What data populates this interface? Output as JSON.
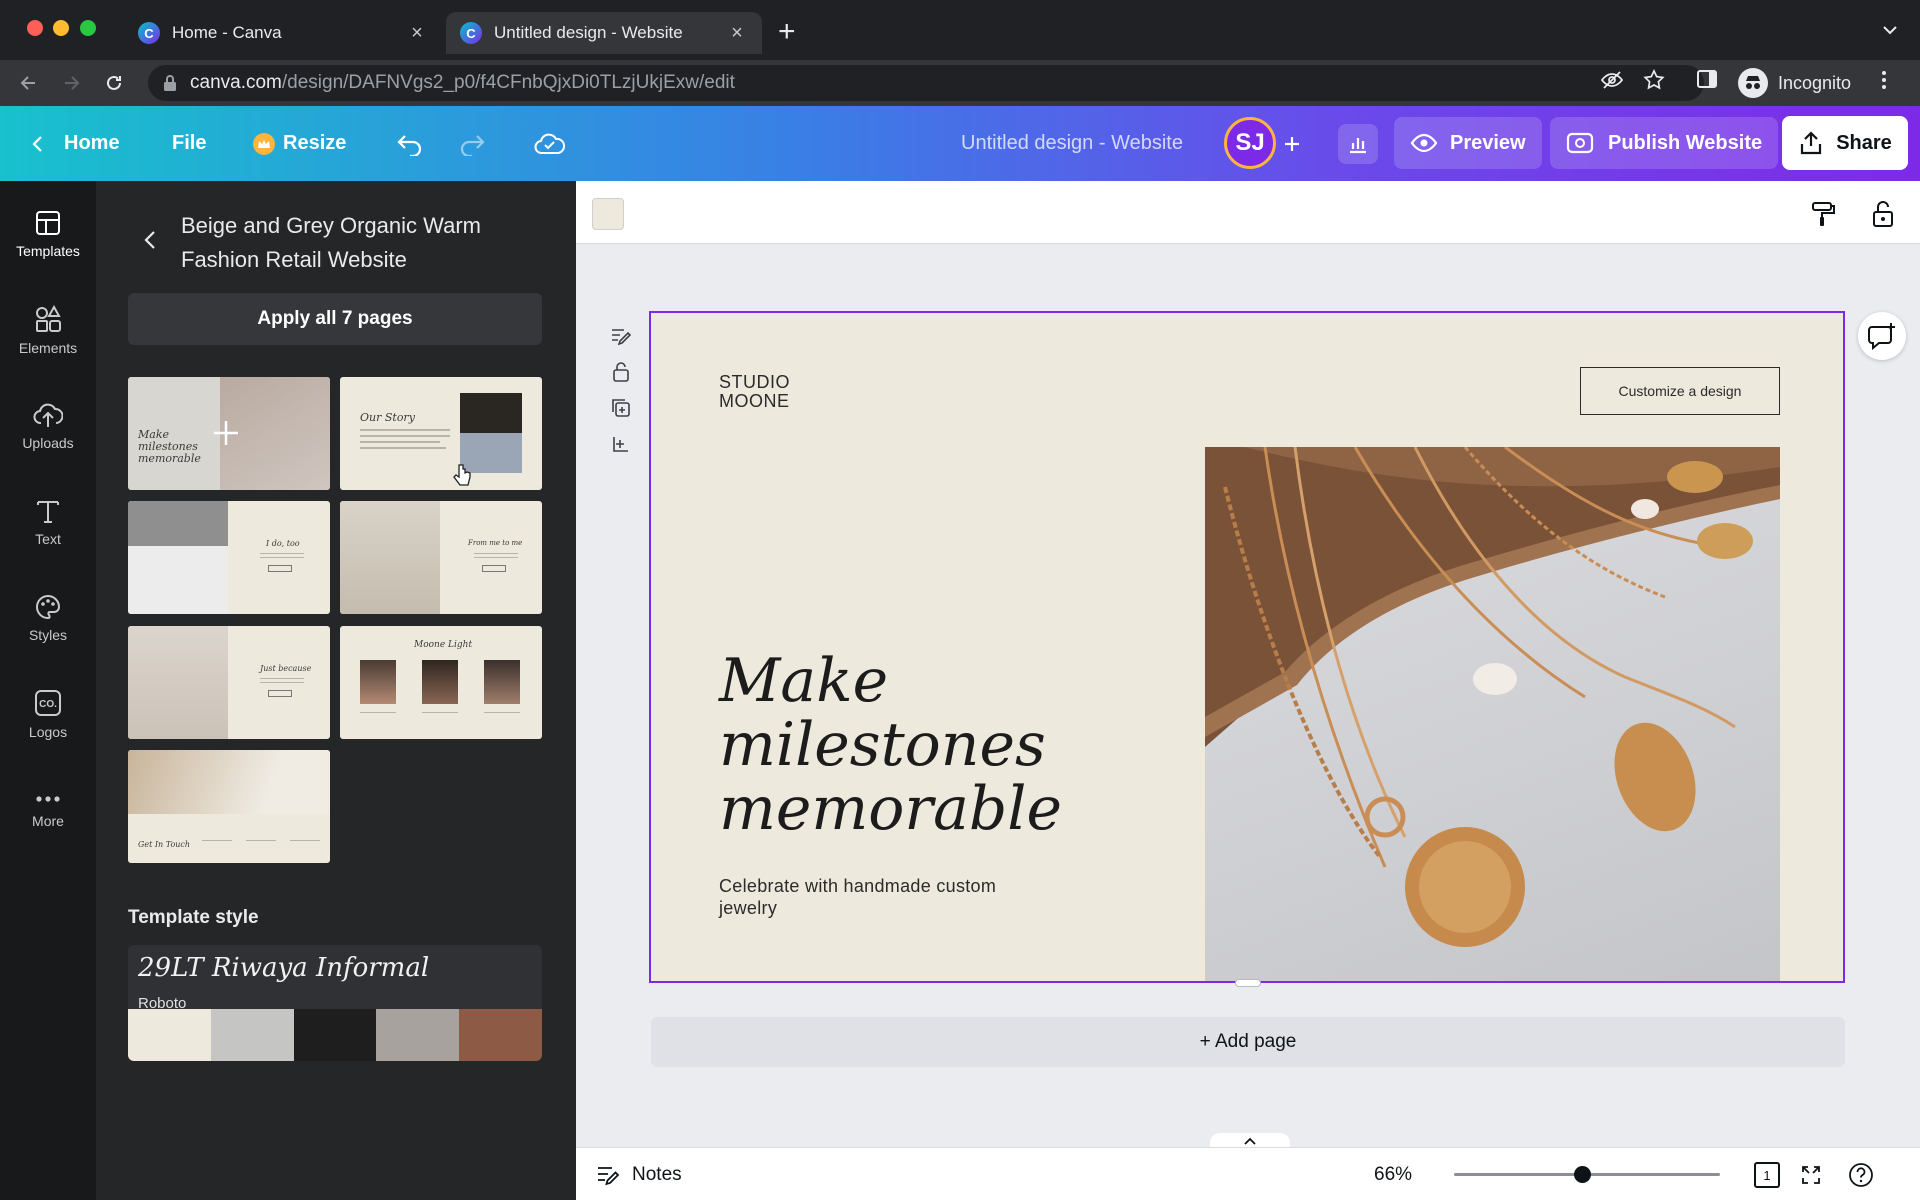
{
  "browser": {
    "tabs": [
      {
        "title": "Home - Canva",
        "favicon": "C"
      },
      {
        "title": "Untitled design - Website",
        "favicon": "C"
      }
    ],
    "new_tab_label": "+",
    "close_glyph": "×",
    "url_host": "canva.com",
    "url_path": "/design/DAFNVgs2_p0/f4CFnbQjxDi0TLzjUkjExw/edit",
    "profile_label": "Incognito"
  },
  "header": {
    "home_label": "Home",
    "file_label": "File",
    "resize_label": "Resize",
    "doc_title": "Untitled design - Website",
    "avatar_initials": "SJ",
    "add_glyph": "+",
    "preview_label": "Preview",
    "publish_label": "Publish Website",
    "share_label": "Share",
    "gradient_start": "#18c1cd",
    "gradient_end": "#7d2ae8"
  },
  "rail": [
    {
      "label": "Templates",
      "icon": "templates-icon"
    },
    {
      "label": "Elements",
      "icon": "elements-icon"
    },
    {
      "label": "Uploads",
      "icon": "uploads-icon"
    },
    {
      "label": "Text",
      "icon": "text-icon"
    },
    {
      "label": "Styles",
      "icon": "styles-icon"
    },
    {
      "label": "Logos",
      "icon": "logos-icon"
    },
    {
      "label": "More",
      "icon": "more-icon"
    }
  ],
  "panel": {
    "title": "Beige and Grey Organic Warm Fashion Retail Website",
    "apply_label": "Apply all 7 pages",
    "thumbnails": [
      {
        "text": "Make milestones memorable"
      },
      {
        "text": "Our Story"
      },
      {
        "text": "I do, too"
      },
      {
        "text": "From me to me"
      },
      {
        "text": "Just because"
      },
      {
        "text": "Moone Light"
      },
      {
        "text": "Get In Touch"
      }
    ],
    "style_label": "Template style",
    "style_font_primary": "29LT Riwaya Informal",
    "style_font_secondary": "Roboto",
    "palette": [
      "#ede9dc",
      "#c5c5c3",
      "#1e1e1e",
      "#a8a29e",
      "#8d5b45"
    ]
  },
  "design": {
    "logo_line1": "STUDIO",
    "logo_line2": "MOONE",
    "cta_label": "Customize a design",
    "headline": "Make milestones memorable",
    "subline": "Celebrate with handmade custom jewelry",
    "background": "#ede9dc",
    "selection_color": "#7d2ae8"
  },
  "add_page_label": "+ Add page",
  "footer": {
    "notes_label": "Notes",
    "zoom": "66%",
    "zoom_level": 0.66,
    "page_count": "1"
  }
}
